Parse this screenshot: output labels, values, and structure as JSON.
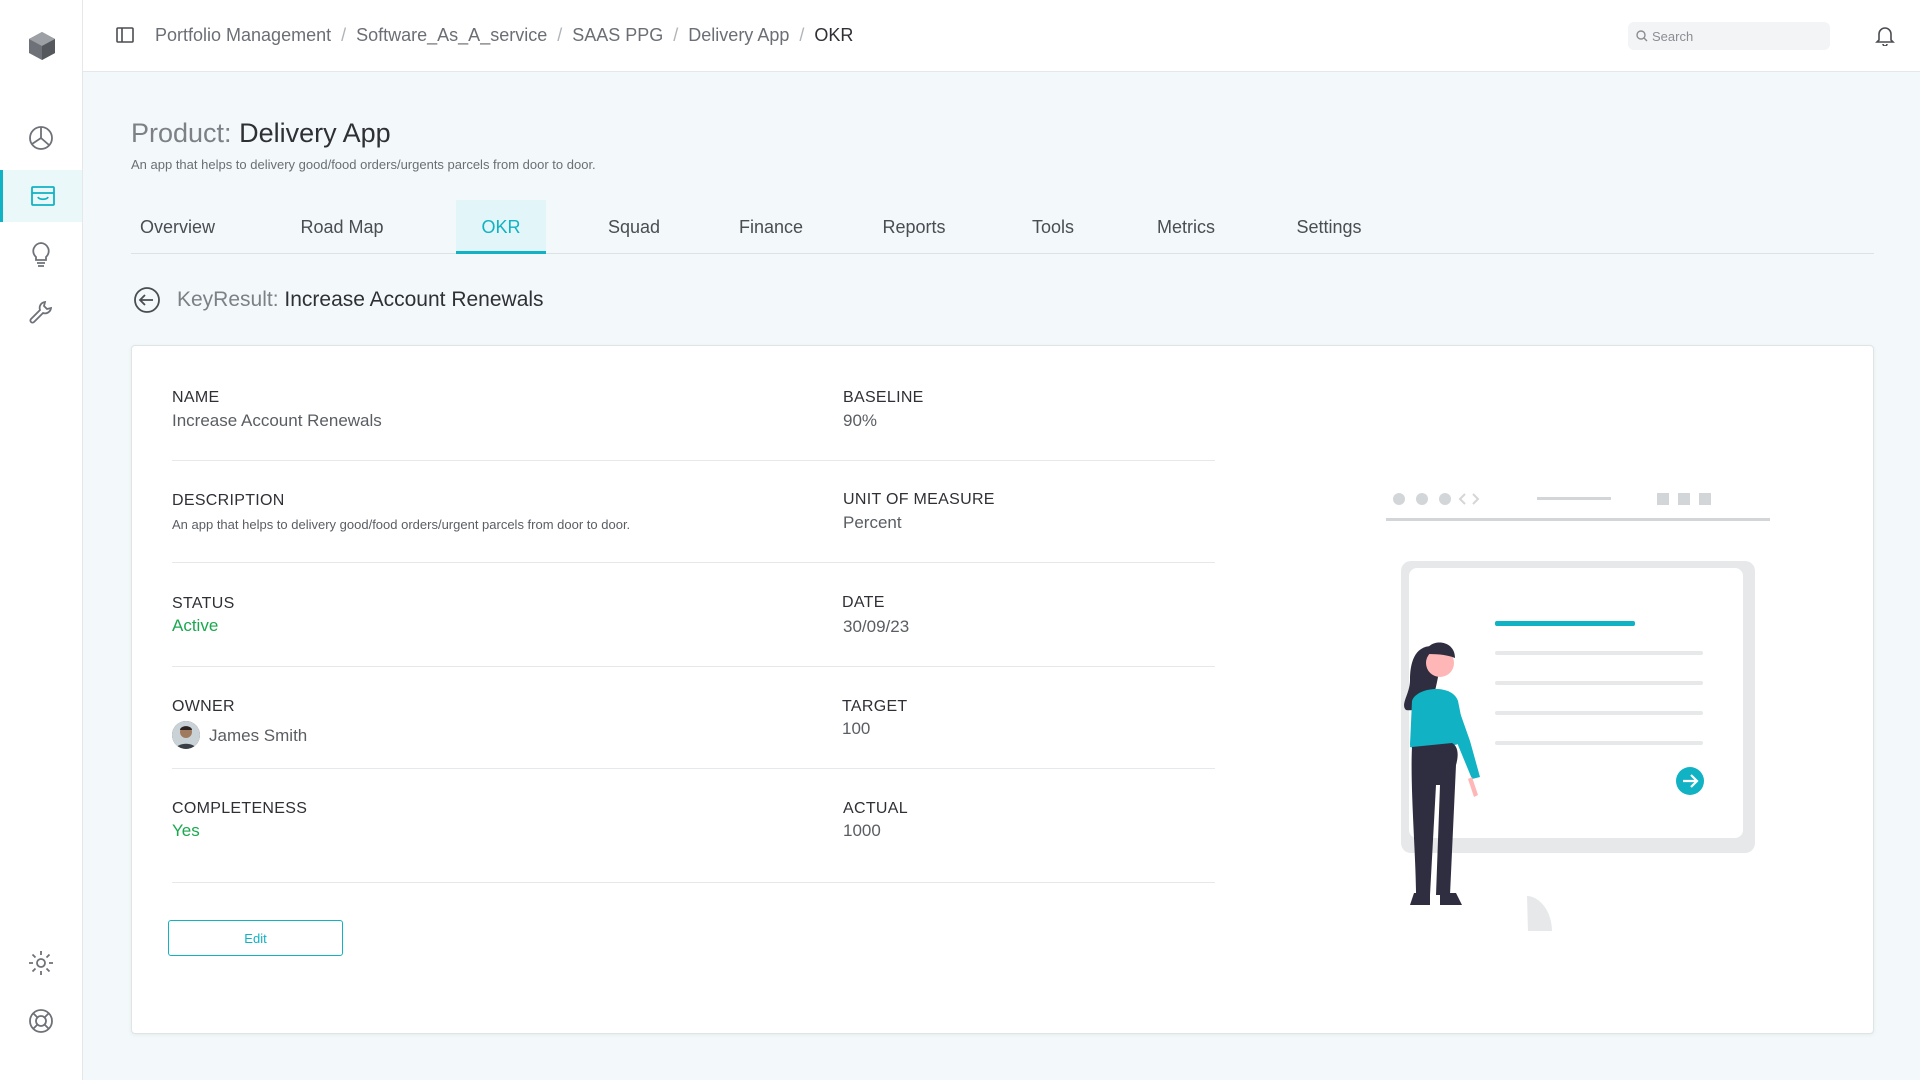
{
  "sidebar": {
    "items": [
      {
        "name": "dashboard",
        "icon": "pie-chart-icon"
      },
      {
        "name": "products",
        "icon": "inbox-icon",
        "active": true
      },
      {
        "name": "ideas",
        "icon": "lightbulb-icon"
      },
      {
        "name": "tools",
        "icon": "wrench-icon"
      },
      {
        "name": "settings",
        "icon": "gear-icon"
      },
      {
        "name": "support",
        "icon": "lifebuoy-icon"
      }
    ]
  },
  "header": {
    "breadcrumb": [
      "Portfolio Management",
      "Software_As_A_service",
      "SAAS PPG",
      "Delivery App",
      "OKR"
    ],
    "search_placeholder": "Search"
  },
  "product": {
    "label": "Product:",
    "name": "Delivery App",
    "description": "An app that helps to delivery good/food orders/urgents parcels from door to door."
  },
  "tabs": [
    "Overview",
    "Road Map",
    "OKR",
    "Squad",
    "Finance",
    "Reports",
    "Tools",
    "Metrics",
    "Settings"
  ],
  "active_tab": "OKR",
  "key_result": {
    "label": "KeyResult:",
    "title": "Increase Account Renewals",
    "fields": {
      "name": {
        "label": "NAME",
        "value": "Increase Account Renewals"
      },
      "baseline": {
        "label": "BASELINE",
        "value": "90%"
      },
      "description": {
        "label": "DESCRIPTION",
        "value": "An app that helps to delivery good/food orders/urgent parcels from door to door."
      },
      "unit": {
        "label": "UNIT OF MEASURE",
        "value": "Percent"
      },
      "status": {
        "label": "STATUS",
        "value": "Active"
      },
      "date": {
        "label": "DATE",
        "value": "30/09/23"
      },
      "owner": {
        "label": "OWNER",
        "value": "James Smith"
      },
      "target": {
        "label": "TARGET",
        "value": "100"
      },
      "completeness": {
        "label": "COMPLETENESS",
        "value": "Yes"
      },
      "actual": {
        "label": "ACTUAL",
        "value": "1000"
      }
    },
    "edit_label": "Edit"
  },
  "colors": {
    "accent": "#10b2c4",
    "positive": "#1aa84e"
  }
}
